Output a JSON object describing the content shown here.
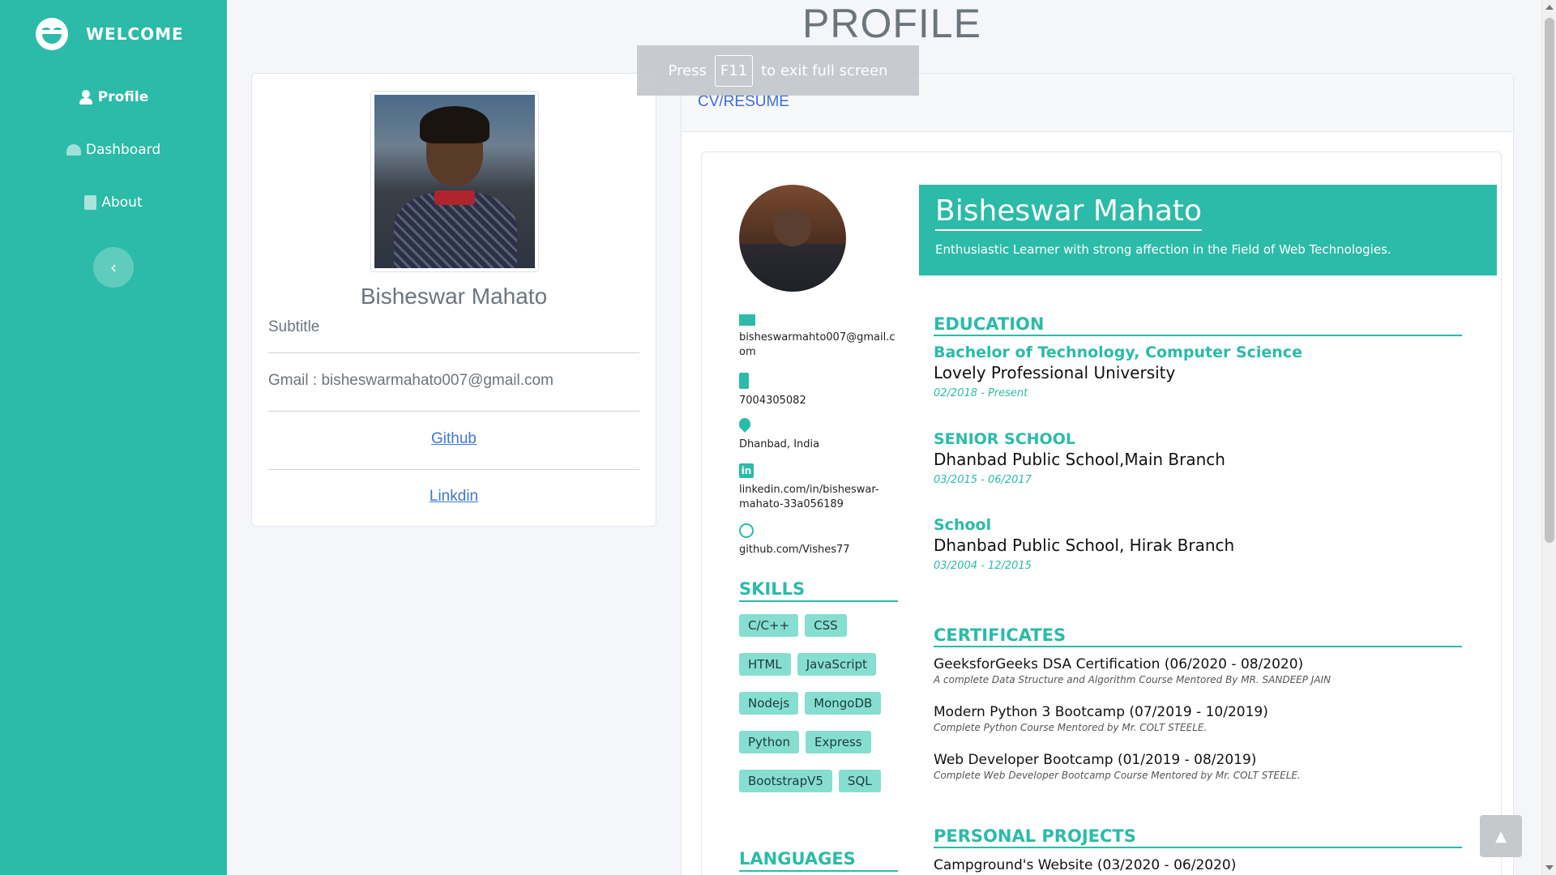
{
  "sidebar": {
    "brand": "WELCOME",
    "items": [
      {
        "label": "Profile"
      },
      {
        "label": "Dashboard"
      },
      {
        "label": "About"
      }
    ]
  },
  "page_title": "PROFILE",
  "toast": {
    "pre": "Press",
    "key": "F11",
    "post": "to exit full screen"
  },
  "profile_card": {
    "name": "Bisheswar Mahato",
    "subtitle": "Subtitle",
    "gmail": "Gmail : bisheswarmahato007@gmail.com",
    "github_label": "Github",
    "linkedin_label": "Linkdin"
  },
  "cv": {
    "header": "CV/RESUME",
    "name": "Bisheswar Mahato",
    "tagline": "Enthusiastic Learner with strong affection in the Field of Web Technologies.",
    "contact": {
      "email": "bisheswarmahto007@gmail.com",
      "phone": "7004305082",
      "location": "Dhanbad, India",
      "linkedin": "linkedin.com/in/bisheswar-mahato-33a056189",
      "github": "github.com/Vishes77"
    },
    "skills_title": "SKILLS",
    "skills": [
      "C/C++",
      "CSS",
      "HTML",
      "JavaScript",
      "Nodejs",
      "MongoDB",
      "Python",
      "Express",
      "BootstrapV5",
      "SQL"
    ],
    "languages_title": "LANGUAGES",
    "education_title": "EDUCATION",
    "education": [
      {
        "degree": "Bachelor of Technology, Computer Science",
        "school": "Lovely Professional University",
        "date": "02/2018 - Present"
      },
      {
        "degree": "SENIOR SCHOOL",
        "school": "Dhanbad Public School,Main Branch",
        "date": "03/2015 - 06/2017"
      },
      {
        "degree": "School",
        "school": "Dhanbad Public School, Hirak Branch",
        "date": "03/2004 - 12/2015"
      }
    ],
    "certificates_title": "CERTIFICATES",
    "certificates": [
      {
        "title": "GeeksforGeeks DSA Certification (06/2020 - 08/2020)",
        "desc": "A complete Data Structure and Algorithm Course Mentored By MR. SANDEEP JAIN"
      },
      {
        "title": "Modern Python 3 Bootcamp (07/2019 - 10/2019)",
        "desc": "Complete Python Course Mentored by Mr. COLT STEELE."
      },
      {
        "title": "Web Developer Bootcamp (01/2019 - 08/2019)",
        "desc": "Complete Web Developer Bootcamp Course Mentored by Mr. COLT STEELE."
      }
    ],
    "projects_title": "PERSONAL PROJECTS",
    "projects": [
      {
        "title": "Campground's Website (03/2020 - 06/2020)"
      }
    ]
  },
  "colors": {
    "accent": "#2bbba8",
    "link": "#3b78d8"
  }
}
